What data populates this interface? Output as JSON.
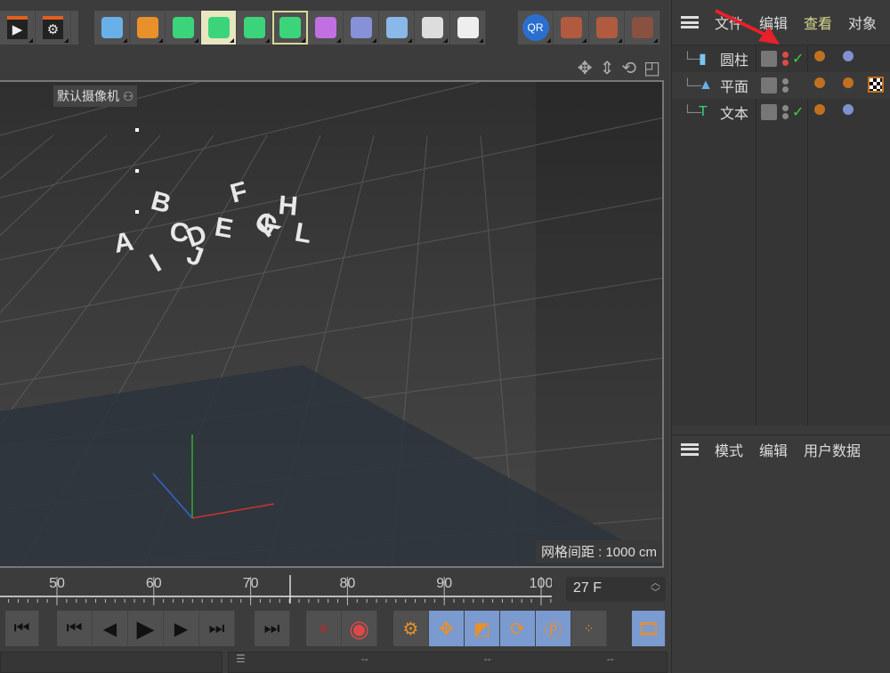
{
  "toolbar": {
    "items": [
      {
        "icon": "render-view-icon",
        "color": "#222"
      },
      {
        "icon": "render-settings-icon",
        "color": "#222"
      },
      {
        "icon": "cube-icon",
        "color": "#6ab0e8"
      },
      {
        "icon": "pen-icon",
        "color": "#e8902a"
      },
      {
        "icon": "subdivision-icon",
        "color": "#3cd47a"
      },
      {
        "icon": "extrude-icon",
        "color": "#3cd47a",
        "selected": true
      },
      {
        "icon": "mograph-icon",
        "color": "#3cd47a"
      },
      {
        "icon": "cloner-icon",
        "color": "#3cd47a",
        "outlined": true
      },
      {
        "icon": "deformer-icon",
        "color": "#c070e0"
      },
      {
        "icon": "bend-icon",
        "color": "#8890d8"
      },
      {
        "icon": "floor-icon",
        "color": "#8ab8e8"
      },
      {
        "icon": "camera-icon",
        "color": "#ddd"
      },
      {
        "icon": "light-icon",
        "color": "#eee"
      },
      {
        "icon": "qr-icon",
        "color": "#2a6fd0",
        "label": "QR"
      },
      {
        "icon": "plugin-icon",
        "color": "#b05a40"
      },
      {
        "icon": "plugin2-icon",
        "color": "#b05a40"
      },
      {
        "icon": "plugin3-icon",
        "color": "#8a5040"
      }
    ]
  },
  "viewport": {
    "camera_label": "默认摄像机",
    "grid_spacing": "网格间距 : 1000 cm",
    "nav_icons": [
      "move-view-icon",
      "zoom-view-icon",
      "rotate-view-icon",
      "maximize-view-icon"
    ],
    "scene_letters": [
      "A",
      "B",
      "C",
      "D",
      "E",
      "F",
      "G",
      "H",
      "I",
      "J",
      "K",
      "L"
    ]
  },
  "object_manager": {
    "menu": [
      "文件",
      "编辑",
      "查看",
      "对象"
    ],
    "highlight_menu": "查看",
    "objects": [
      {
        "name": "圆柱",
        "icon": "cylinder-icon",
        "dots": [
          "#e04848",
          "#e04848"
        ],
        "check": true
      },
      {
        "name": "平面",
        "icon": "plane-icon",
        "dots": [
          "#888",
          "#888"
        ],
        "check": false
      },
      {
        "name": "文本",
        "icon": "text-icon",
        "dots": [
          "#888",
          "#888"
        ],
        "check": true
      }
    ]
  },
  "attribute_manager": {
    "menu": [
      "模式",
      "编辑",
      "用户数据"
    ]
  },
  "timeline": {
    "ticks": [
      50,
      60,
      70,
      80,
      90,
      100
    ],
    "current_frame": "27 F",
    "marker_frame": 75
  },
  "playback": {
    "buttons": [
      "go-to-start-icon",
      "prev-key-icon",
      "prev-frame-icon",
      "play-icon",
      "next-frame-icon",
      "next-key-icon",
      "go-to-end-icon"
    ]
  },
  "status": {
    "fields": [
      "--",
      "--",
      "--"
    ]
  },
  "accent_colors": {
    "arrow": "#e8202a",
    "selected": "#7a9ad0"
  }
}
